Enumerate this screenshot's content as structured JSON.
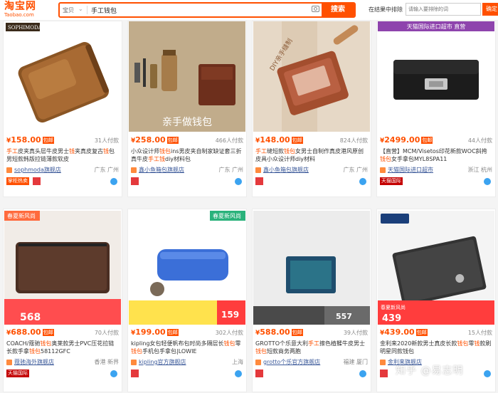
{
  "header": {
    "logo_cn": "淘宝网",
    "logo_en": "Taobao.com",
    "search_scope": "宝贝",
    "search_value": "手工钱包",
    "search_button": "搜索",
    "within_label": "在结果中排除",
    "within_placeholder": "请输入要排除的词",
    "within_button": "确定"
  },
  "products": [
    {
      "price_symbol": "¥",
      "price": "158.00",
      "tag": "包邮",
      "sales": "31人付款",
      "title_parts": [
        "手工",
        "皮夹真头层牛皮男士",
        "钱",
        "夹真皮复古",
        "钱",
        "包男短款韩版拉链薄款软皮"
      ],
      "shop": "sophmoda旗舰店",
      "location": "广东 广州",
      "image_caption": "SOPHIMODA",
      "badges": [
        "掌柜热卖"
      ]
    },
    {
      "price_symbol": "¥",
      "price": "258.00",
      "tag": "包邮",
      "sales": "466人付款",
      "title_parts": [
        "小众设计师",
        "钱包",
        "ins男皮夹自制家缺证套三折真牛皮",
        "手工",
        "钱",
        "diy材料包"
      ],
      "shop": "鑫小鱼箱包旗舰店",
      "location": "广东 广州",
      "image_caption": "亲手做钱包",
      "badges": []
    },
    {
      "price_symbol": "¥",
      "price": "148.00",
      "tag": "包邮",
      "sales": "824人付款",
      "title_parts": [
        "手工",
        "缝",
        "短款",
        "钱包",
        "女男士自制作真皮港风原创皮具小众设计师diy材料"
      ],
      "shop": "鑫小鱼箱包旗舰店",
      "location": "广东 广州",
      "image_caption": "DIY亲手缝制",
      "badges": []
    },
    {
      "price_symbol": "¥",
      "price": "2499.00",
      "tag": "包邮",
      "sales": "44人付款",
      "title_parts": [
        "【直营】MCM/Visetos印花新款WOC斜挎",
        "钱包",
        "女手拿包MYL8SPA11"
      ],
      "shop": "天猫国际进口超市",
      "location": "浙江 杭州",
      "image_caption": "天猫国际进口超市 直营",
      "badges": [
        "天猫国际"
      ]
    },
    {
      "price_symbol": "¥",
      "price": "688.00",
      "tag": "包邮",
      "sales": "70人付款",
      "title_parts": [
        "COACH/蔻驰",
        "钱包",
        "奥莱款男士PVC压花拉链长款手拿",
        "钱包",
        "58112GFC"
      ],
      "shop": "蔻驰海外旗舰店",
      "location": "香港 新界",
      "image_caption": "春夏新风尚",
      "promo_price": "568",
      "badges": [
        "天猫国际"
      ]
    },
    {
      "price_symbol": "¥",
      "price": "199.00",
      "tag": "包邮",
      "sales": "302人付款",
      "title_parts": [
        "kipling女包轻便帆布包时尚多隔层长",
        "钱包",
        "零",
        "钱包",
        "手机包手拿包|LOWIE"
      ],
      "shop": "kipling官方旗舰店",
      "location": "上海",
      "image_caption": "春夏新风尚",
      "promo_price": "159",
      "badges": [
        "天猫"
      ]
    },
    {
      "price_symbol": "¥",
      "price": "588.00",
      "tag": "包邮",
      "sales": "39人付款",
      "title_parts": [
        "GROTTO个乐意大利",
        "手工",
        "擦色植鞣牛皮男士",
        "钱包",
        "短款商务两胞"
      ],
      "shop": "grotto个乐官方旗舰店",
      "location": "福建 厦门",
      "image_caption": "",
      "promo_price": "557",
      "badges": [
        "天猫"
      ]
    },
    {
      "price_symbol": "¥",
      "price": "439.00",
      "tag": "包邮",
      "sales": "15人付款",
      "title_parts": [
        "金利来2020新款男士真皮长款",
        "钱包",
        "零",
        "钱",
        "款刷明星同款钱包"
      ],
      "shop": "金利来旗舰店",
      "location": "",
      "image_caption": "春夏新风尚",
      "promo_price": "439",
      "badges": [
        "天猫"
      ]
    }
  ],
  "watermark": "知乎 @易志明"
}
